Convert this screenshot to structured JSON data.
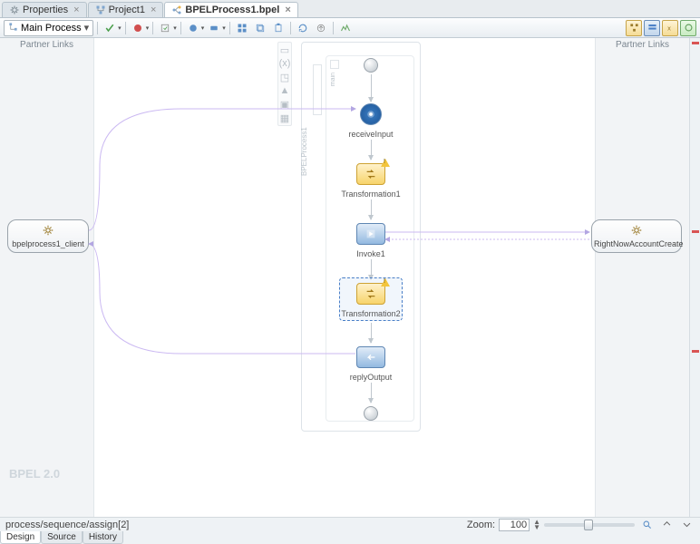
{
  "tabs": [
    {
      "label": "Properties",
      "icon": "gear-icon"
    },
    {
      "label": "Project1",
      "icon": "tree-icon"
    },
    {
      "label": "BPELProcess1.bpel",
      "icon": "process-icon",
      "active": true
    }
  ],
  "toolbar": {
    "scope_label": "Main Process"
  },
  "partner_header": "Partner Links",
  "partners": {
    "left": {
      "label": "bpelprocess1_client"
    },
    "right": {
      "label": "RightNowAccountCreate"
    }
  },
  "lane": {
    "vertical_label": "BPELProcess1",
    "inner_label": "main"
  },
  "nodes": {
    "receive": {
      "label": "receiveInput"
    },
    "xform1": {
      "label": "Transformation1"
    },
    "invoke": {
      "label": "Invoke1"
    },
    "xform2": {
      "label": "Transformation2"
    },
    "reply": {
      "label": "replyOutput"
    }
  },
  "footer": {
    "version": "BPEL 2.0",
    "breadcrumb": "process/sequence/assign[2]",
    "zoom_label": "Zoom:",
    "zoom_value": "100"
  },
  "bottom_tabs": [
    {
      "label": "Design",
      "active": true
    },
    {
      "label": "Source"
    },
    {
      "label": "History"
    }
  ]
}
